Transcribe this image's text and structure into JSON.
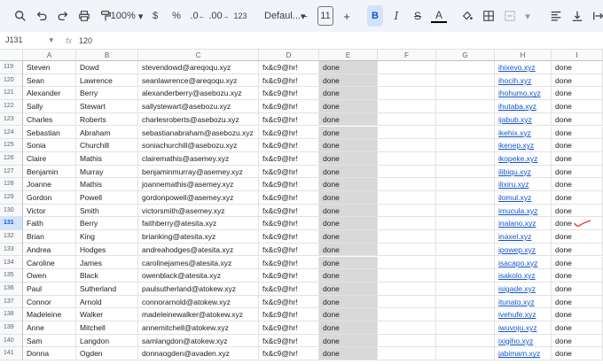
{
  "toolbar": {
    "zoom": "100%",
    "currency": "$",
    "percent": "%",
    "dec_decrease": ".0",
    "dec_increase": ".00",
    "format_123": "123",
    "font": "Defaul...",
    "font_size": "11",
    "minus": "−",
    "plus": "+",
    "bold": "B",
    "italic": "I",
    "strike": "S",
    "text_color": "A"
  },
  "formula_bar": {
    "cell_ref": "J131",
    "fx": "fx",
    "value": "120"
  },
  "columns": [
    "A",
    "B",
    "C",
    "D",
    "E",
    "F",
    "G",
    "H",
    "I"
  ],
  "selected_row": "131",
  "rows": [
    {
      "num": "119",
      "a": "Steven",
      "b": "Dowd",
      "c": "stevendowd@areqoqu.xyz",
      "d": "fx&c9@hr!",
      "e": "done",
      "h": "ihixevo.xyz",
      "i": "done"
    },
    {
      "num": "120",
      "a": "Sean",
      "b": "Lawrence",
      "c": "seanlawrence@areqoqu.xyz",
      "d": "fx&c9@hr!",
      "e": "done",
      "h": "ihocih.xyz",
      "i": "done"
    },
    {
      "num": "121",
      "a": "Alexander",
      "b": "Berry",
      "c": "alexanderberry@asebozu.xyz",
      "d": "fx&c9@hr!",
      "e": "done",
      "h": "ihohumo.xyz",
      "i": "done"
    },
    {
      "num": "122",
      "a": "Sally",
      "b": "Stewart",
      "c": "sallystewart@asebozu.xyz",
      "d": "fx&c9@hr!",
      "e": "done",
      "h": "ihutaba.xyz",
      "i": "done"
    },
    {
      "num": "123",
      "a": "Charles",
      "b": "Roberts",
      "c": "charlesroberts@asebozu.xyz",
      "d": "fx&c9@hr!",
      "e": "done",
      "h": "ijabub.xyz",
      "i": "done"
    },
    {
      "num": "124",
      "a": "Sebastian",
      "b": "Abraham",
      "c": "sebastianabraham@asebozu.xyz",
      "d": "fx&c9@hr!",
      "e": "done",
      "h": "ikehix.xyz",
      "i": "done"
    },
    {
      "num": "125",
      "a": "Sonia",
      "b": "Churchill",
      "c": "soniachurchill@asebozu.xyz",
      "d": "fx&c9@hr!",
      "e": "done",
      "h": "ikenep.xyz",
      "i": "done"
    },
    {
      "num": "126",
      "a": "Claire",
      "b": "Mathis",
      "c": "clairemathis@asemey.xyz",
      "d": "fx&c9@hr!",
      "e": "done",
      "h": "ikopeke.xyz",
      "i": "done"
    },
    {
      "num": "127",
      "a": "Benjamin",
      "b": "Murray",
      "c": "benjaminmurray@asemey.xyz",
      "d": "fx&c9@hr!",
      "e": "done",
      "h": "ilibiqu.xyz",
      "i": "done"
    },
    {
      "num": "128",
      "a": "Joanne",
      "b": "Mathis",
      "c": "joannemathis@asemey.xyz",
      "d": "fx&c9@hr!",
      "e": "done",
      "h": "ilixiru.xyz",
      "i": "done"
    },
    {
      "num": "129",
      "a": "Gordon",
      "b": "Powell",
      "c": "gordonpowell@asemey.xyz",
      "d": "fx&c9@hr!",
      "e": "done",
      "h": "ilomul.xyz",
      "i": "done"
    },
    {
      "num": "130",
      "a": "Victor",
      "b": "Smith",
      "c": "victorsmith@asemey.xyz",
      "d": "fx&c9@hr!",
      "e": "done",
      "h": "imucula.xyz",
      "i": "done"
    },
    {
      "num": "131",
      "a": "Faith",
      "b": "Berry",
      "c": "faithberry@atesita.xyz",
      "d": "fx&c9@hr!",
      "e": "done",
      "h": "inalano.xyz",
      "i": "done"
    },
    {
      "num": "132",
      "a": "Brian",
      "b": "King",
      "c": "brianking@atesita.xyz",
      "d": "fx&c9@hr!",
      "e": "done",
      "h": "inaxel.xyz",
      "i": "done"
    },
    {
      "num": "133",
      "a": "Andrea",
      "b": "Hodges",
      "c": "andreahodges@atesita.xyz",
      "d": "fx&c9@hr!",
      "e": "done",
      "h": "ipowep.xyz",
      "i": "done"
    },
    {
      "num": "134",
      "a": "Caroline",
      "b": "James",
      "c": "carolinejames@atesita.xyz",
      "d": "fx&c9@hr!",
      "e": "done",
      "h": "isacapo.xyz",
      "i": "done"
    },
    {
      "num": "135",
      "a": "Owen",
      "b": "Black",
      "c": "owenblack@atesita.xyz",
      "d": "fx&c9@hr!",
      "e": "done",
      "h": "isakolo.xyz",
      "i": "done"
    },
    {
      "num": "136",
      "a": "Paul",
      "b": "Sutherland",
      "c": "paulsutherland@atokew.xyz",
      "d": "fx&c9@hr!",
      "e": "done",
      "h": "isigade.xyz",
      "i": "done"
    },
    {
      "num": "137",
      "a": "Connor",
      "b": "Arnold",
      "c": "connorarnold@atokew.xyz",
      "d": "fx&c9@hr!",
      "e": "done",
      "h": "itunato.xyz",
      "i": "done"
    },
    {
      "num": "138",
      "a": "Madeleine",
      "b": "Walker",
      "c": "madeleinewalker@atokew.xyz",
      "d": "fx&c9@hr!",
      "e": "done",
      "h": "ivehufe.xyz",
      "i": "done"
    },
    {
      "num": "139",
      "a": "Anne",
      "b": "Mitchell",
      "c": "annemitchell@atokew.xyz",
      "d": "fx&c9@hr!",
      "e": "done",
      "h": "iwuvoju.xyz",
      "i": "done"
    },
    {
      "num": "140",
      "a": "Sam",
      "b": "Langdon",
      "c": "samlangdon@atokew.xyz",
      "d": "fx&c9@hr!",
      "e": "done",
      "h": "ixigiho.xyz",
      "i": "done"
    },
    {
      "num": "141",
      "a": "Donna",
      "b": "Ogden",
      "c": "donnaogden@avaden.xyz",
      "d": "fx&c9@hr!",
      "e": "done",
      "h": "jabimam.xyz",
      "i": "done"
    }
  ],
  "colors": {
    "toolbar_bg": "#f1f4f9",
    "link": "#1155cc",
    "shade": "#d9d9d9",
    "selected": "#d3e3fd",
    "annotation": "#e53935"
  }
}
